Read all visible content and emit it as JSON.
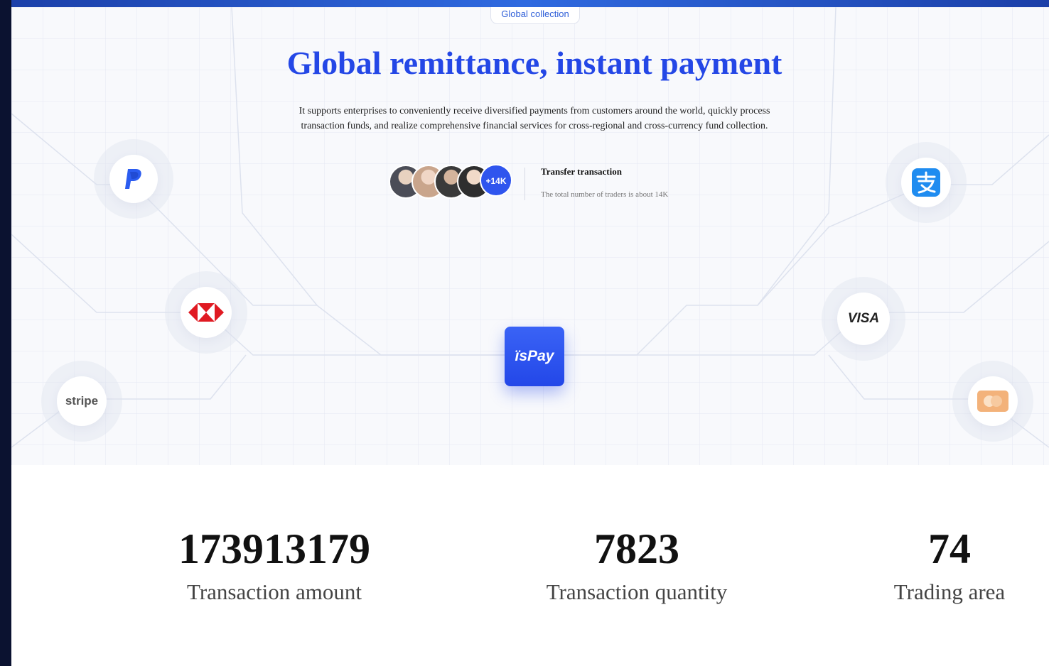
{
  "hero": {
    "tag": "Global collection",
    "title": "Global remittance, instant payment",
    "description_line1": "It supports enterprises to conveniently receive diversified payments from customers around the world, quickly process",
    "description_line2": "transaction funds, and realize comprehensive financial services for cross-regional and cross-currency fund collection.",
    "traders": {
      "more_badge": "+14K",
      "title": "Transfer transaction",
      "subtitle": "The total number of traders is about 14K"
    },
    "center_logo": "ïsPay",
    "partners": [
      {
        "name": "paypal",
        "icon": "paypal-logo",
        "color": "#2b5cf0"
      },
      {
        "name": "hsbc",
        "icon": "hsbc-logo",
        "color": "#e01a22"
      },
      {
        "name": "stripe",
        "label": "stripe",
        "color": "#555555"
      },
      {
        "name": "alipay",
        "icon": "alipay-logo",
        "color": "#1f8cf0"
      },
      {
        "name": "visa",
        "label": "VISA",
        "color": "#222222"
      },
      {
        "name": "mastercard",
        "icon": "mastercard-logo",
        "color": "#f3b27a"
      }
    ]
  },
  "stats": [
    {
      "value": "173913179",
      "label": "Transaction amount"
    },
    {
      "value": "7823",
      "label": "Transaction quantity"
    },
    {
      "value": "74",
      "label": "Trading area"
    }
  ]
}
